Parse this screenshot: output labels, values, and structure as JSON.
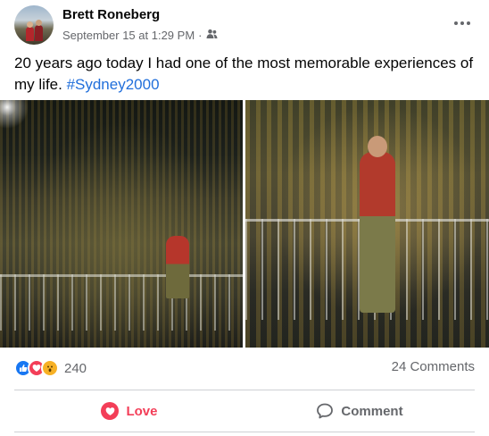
{
  "post": {
    "author": "Brett Roneberg",
    "timestamp": "September 15 at 1:29 PM",
    "separator": "·",
    "audience_icon": "friends-icon",
    "more_icon": "more-options-icon",
    "text_main": "20 years ago today I had one of the most memorable experiences of my life. ",
    "hashtag": "#Sydney2000"
  },
  "reactions": {
    "icons": [
      "like-icon",
      "love-icon",
      "wow-icon"
    ],
    "count": "240",
    "comments": "24 Comments"
  },
  "actions": {
    "love_label": "Love",
    "comment_label": "Comment"
  },
  "colors": {
    "love": "#f33e58",
    "like": "#1877f2",
    "wow": "#f7b125",
    "hashtag": "#216fdb",
    "secondary_text": "#65676b"
  }
}
